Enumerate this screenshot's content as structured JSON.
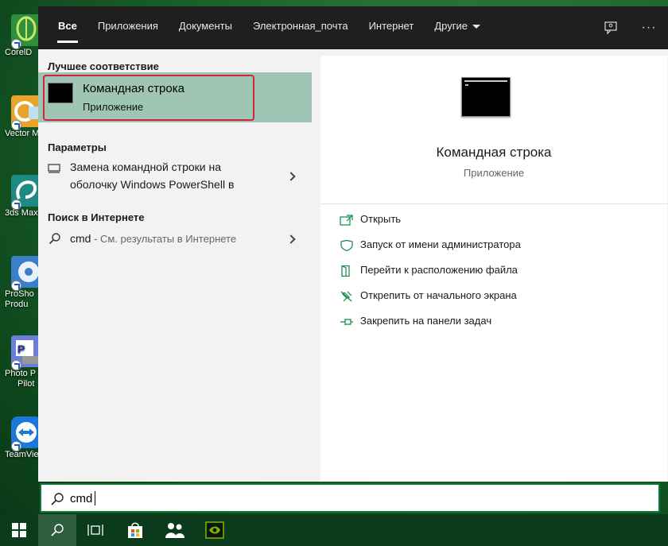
{
  "desktop": {
    "icons": [
      {
        "label": "CorelD"
      },
      {
        "label": "Vector M"
      },
      {
        "label": "3ds Max"
      },
      {
        "label": "ProSho",
        "label2": "Produ"
      },
      {
        "label": "Photo P",
        "label2": "Pilot"
      },
      {
        "label": "TeamVie"
      }
    ]
  },
  "nav": {
    "tabs": [
      {
        "label": "Все"
      },
      {
        "label": "Приложения"
      },
      {
        "label": "Документы"
      },
      {
        "label": "Электронная_почта"
      },
      {
        "label": "Интернет"
      },
      {
        "label": "Другие"
      }
    ],
    "feedback_icon": "feedback-icon",
    "more_label": "···"
  },
  "results": {
    "best_match_title": "Лучшее соответствие",
    "best_match": {
      "name": "Командная строка",
      "type": "Приложение"
    },
    "settings_title": "Параметры",
    "settings_item": {
      "line1": "Замена командной строки на",
      "line2": "оболочку Windows PowerShell в"
    },
    "web_title": "Поиск в Интернете",
    "web_item": {
      "query": "cmd",
      "suffix": " - См. результаты в Интернете"
    }
  },
  "preview": {
    "title": "Командная строка",
    "subtitle": "Приложение",
    "actions": [
      {
        "label": "Открыть",
        "icon": "open-icon"
      },
      {
        "label": "Запуск от имени администратора",
        "icon": "admin-shield-icon"
      },
      {
        "label": "Перейти к расположению файла",
        "icon": "file-location-icon"
      },
      {
        "label": "Открепить от начального экрана",
        "icon": "unpin-icon"
      },
      {
        "label": "Закрепить на панели задач",
        "icon": "pin-taskbar-icon"
      }
    ]
  },
  "search": {
    "value": "cmd"
  },
  "colors": {
    "accent_border": "#0a7b3c",
    "highlight": "#9fc5b4",
    "selection_frame": "#d6213a",
    "nav_bg": "#1f1f1f"
  }
}
